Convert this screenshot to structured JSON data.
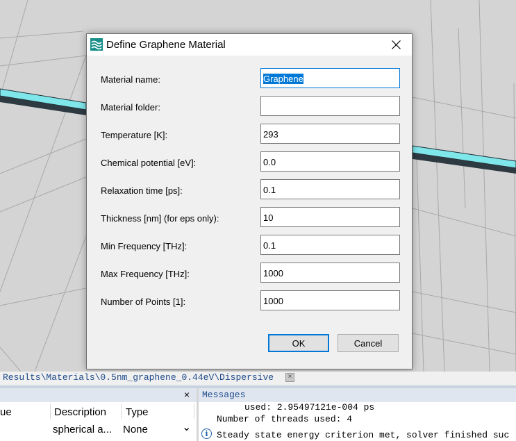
{
  "dialog": {
    "title": "Define Graphene Material",
    "fields": [
      {
        "label": "Material name:",
        "value": "Graphene"
      },
      {
        "label": "Material folder:",
        "value": ""
      },
      {
        "label": "Temperature [K]:",
        "value": "293"
      },
      {
        "label": "Chemical potential [eV]:",
        "value": "0.0"
      },
      {
        "label": "Relaxation time [ps]:",
        "value": "0.1"
      },
      {
        "label": "Thickness [nm] (for eps only):",
        "value": "10"
      },
      {
        "label": "Min Frequency [THz]:",
        "value": "0.1"
      },
      {
        "label": "Max Frequency [THz]:",
        "value": "1000"
      },
      {
        "label": "Number of Points [1]:",
        "value": "1000"
      }
    ],
    "ok_label": "OK",
    "cancel_label": "Cancel"
  },
  "pathbar": {
    "text": "Results\\Materials\\0.5nm_graphene_0.44eV\\Dispersive",
    "close_glyph": "×"
  },
  "left_panel": {
    "close_glyph": "×",
    "columns": [
      "ue",
      "Description",
      "Type"
    ],
    "row": {
      "description": "spherical a...",
      "type": "None"
    },
    "dropdown_glyph": "⌄"
  },
  "messages": {
    "title": "Messages",
    "lines": [
      "used: 2.95497121e-004 ps",
      "Number of threads used: 4",
      "Steady state energy criterion met, solver finished suc"
    ]
  },
  "colors": {
    "accent": "#0078d7",
    "background_strip": "#7fe6ea",
    "panel_header": "#dfe6f0"
  }
}
